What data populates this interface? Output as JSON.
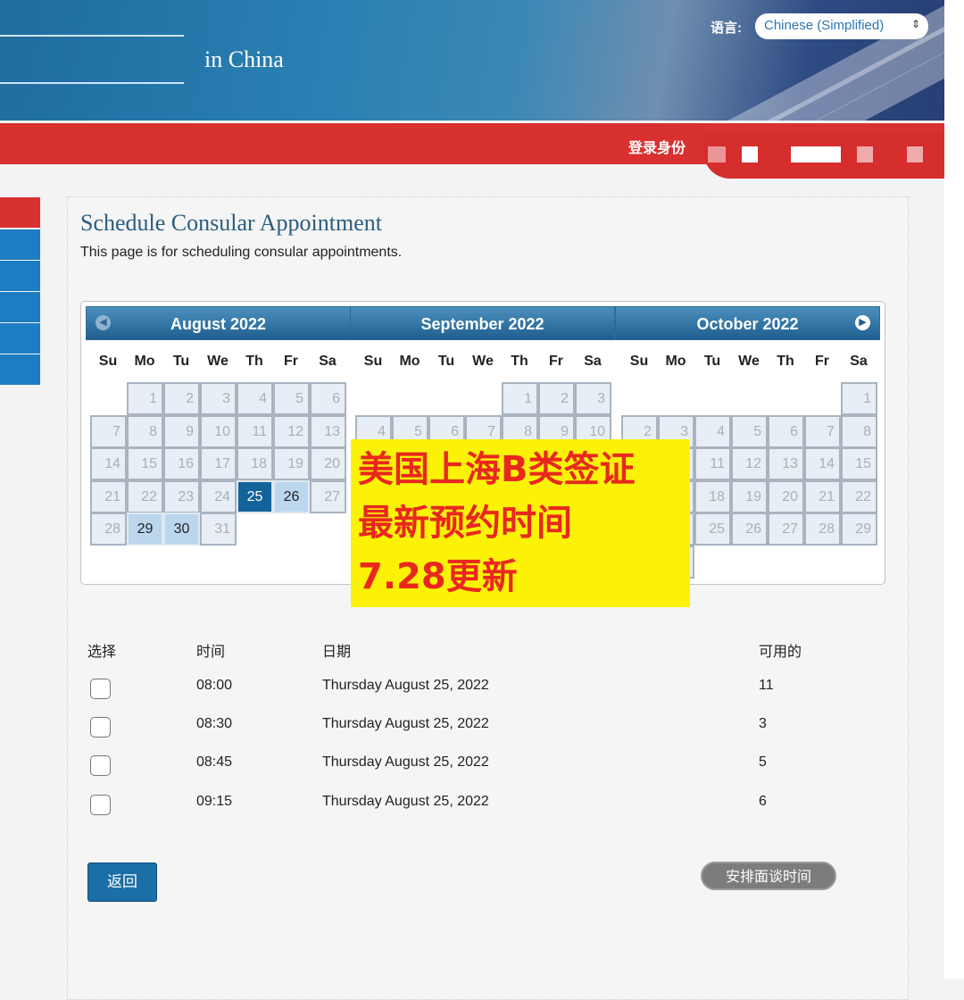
{
  "header": {
    "title_fragment": "in China",
    "language_label": "语言:",
    "language_value": "Chinese (Simplified)",
    "login_label": "登录身份"
  },
  "page": {
    "title": "Schedule Consular Appointment",
    "subtitle": "This page is for scheduling consular appointments."
  },
  "calendar": {
    "weekdays": [
      "Su",
      "Mo",
      "Tu",
      "We",
      "Th",
      "Fr",
      "Sa"
    ],
    "months": [
      {
        "label": "August 2022",
        "days": 31,
        "first_weekday": 1,
        "available": [
          26,
          29,
          30
        ],
        "selected": 25
      },
      {
        "label": "September 2022",
        "days": 30,
        "first_weekday": 4,
        "available": [],
        "selected": null
      },
      {
        "label": "October 2022",
        "days": 31,
        "first_weekday": 6,
        "available": [],
        "selected": null
      }
    ],
    "prev_icon": "chevron-left-icon",
    "next_icon": "chevron-right-icon"
  },
  "overlay": {
    "lines": [
      "美国上海B类签证",
      "最新预约时间",
      "7.28更新"
    ]
  },
  "table": {
    "headers": [
      "选择",
      "时间",
      "日期",
      "可用的"
    ],
    "rows": [
      {
        "time": "08:00",
        "date": "Thursday August 25, 2022",
        "available": "11"
      },
      {
        "time": "08:30",
        "date": "Thursday August 25, 2022",
        "available": "3"
      },
      {
        "time": "08:45",
        "date": "Thursday August 25, 2022",
        "available": "5"
      },
      {
        "time": "09:15",
        "date": "Thursday August 25, 2022",
        "available": "6"
      }
    ]
  },
  "buttons": {
    "back": "返回",
    "schedule": "安排面谈时间"
  },
  "colors": {
    "accent_blue": "#1b6ea6",
    "header_red": "#d93030",
    "selected_day": "#12639a",
    "available_day": "#bcd6ee",
    "overlay_bg": "#fbf208",
    "overlay_text": "#e8281e"
  }
}
